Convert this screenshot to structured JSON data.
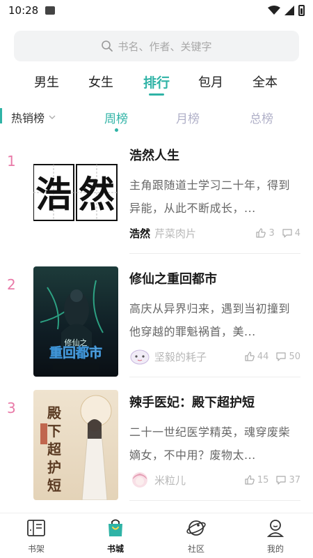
{
  "status_bar": {
    "time": "10:28"
  },
  "search": {
    "placeholder": "书名、作者、关键字"
  },
  "main_tabs": [
    {
      "label": "男生"
    },
    {
      "label": "女生"
    },
    {
      "label": "排行",
      "active": true
    },
    {
      "label": "包月"
    },
    {
      "label": "全本"
    }
  ],
  "ranking": {
    "list_selector": "热销榜",
    "tabs": [
      {
        "label": "周榜",
        "active": true
      },
      {
        "label": "月榜"
      },
      {
        "label": "总榜"
      }
    ]
  },
  "books": [
    {
      "rank": "1",
      "title": "浩然人生",
      "description": "主角跟随道士学习二十年，得到异能，从此不断成长，...",
      "author": "芹菜肉片",
      "likes": "3",
      "comments": "4",
      "cover_text": "浩然"
    },
    {
      "rank": "2",
      "title": "修仙之重回都市",
      "description": "高庆从异界归来，遇到当初撞到他穿越的罪魁祸首，美...",
      "author": "坚毅的耗子",
      "likes": "44",
      "comments": "50",
      "cover_text": "修仙之重回都市"
    },
    {
      "rank": "3",
      "title": "辣手医妃：殿下超护短",
      "description": "二十一世纪医学精英，魂穿废柴嫡女，不中用？废物太...",
      "author": "米粒儿",
      "likes": "15",
      "comments": "37",
      "cover_text": "殿下超护短"
    }
  ],
  "bottom_nav": [
    {
      "label": "书架"
    },
    {
      "label": "书城",
      "active": true
    },
    {
      "label": "社区"
    },
    {
      "label": "我的"
    }
  ],
  "colors": {
    "accent": "#2fb3a6",
    "rank": "#e97aa8"
  }
}
